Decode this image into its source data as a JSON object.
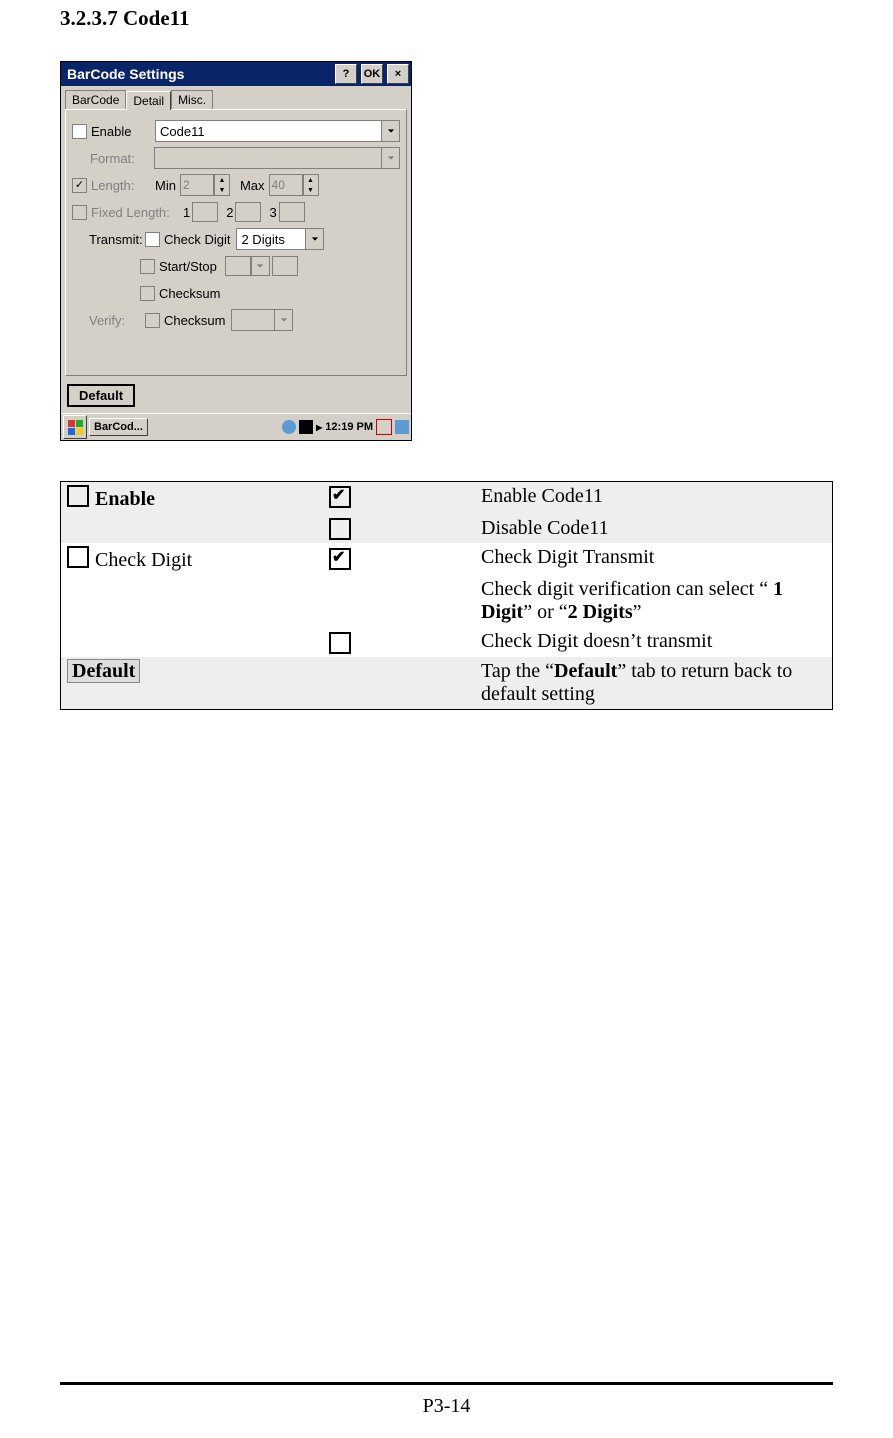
{
  "section_heading": "3.2.3.7 Code11",
  "window": {
    "title": "BarCode Settings",
    "help_label": "?",
    "ok_label": "OK",
    "close_label": "×",
    "tabs": {
      "barcode": "BarCode",
      "detail": "Detail",
      "misc": "Misc."
    },
    "fields": {
      "enable_label": "Enable",
      "symbology": "Code11",
      "format_label": "Format:",
      "length_label": "Length:",
      "min_label": "Min",
      "min_val": "2",
      "max_label": "Max",
      "max_val": "40",
      "fixed_label": "Fixed Length:",
      "fixed_nums": [
        "1",
        "2",
        "3"
      ],
      "transmit_label": "Transmit:",
      "check_digit_label": "Check Digit",
      "check_digit_sel": "2 Digits",
      "startstop_label": "Start/Stop",
      "checksum_label": "Checksum",
      "verify_label": "Verify:"
    },
    "default_btn": "Default",
    "taskbar": {
      "app": "BarCod...",
      "time": "12:19 PM"
    }
  },
  "table": {
    "enable": {
      "label": "Enable",
      "on": "Enable Code11",
      "off": "Disable Code11"
    },
    "check_digit": {
      "label": "Check Digit",
      "on1": "Check Digit Transmit",
      "on2a": "Check digit verification can select “ ",
      "on2b": "1 Digit",
      "on2c": "” or “",
      "on2d": "2 Digits",
      "on2e": "”",
      "off": "Check Digit doesn’t transmit"
    },
    "default": {
      "label": "Default",
      "desc_a": "Tap the “",
      "desc_b": "Default",
      "desc_c": "” tab to return back to default setting"
    }
  },
  "page_number": "P3-14"
}
